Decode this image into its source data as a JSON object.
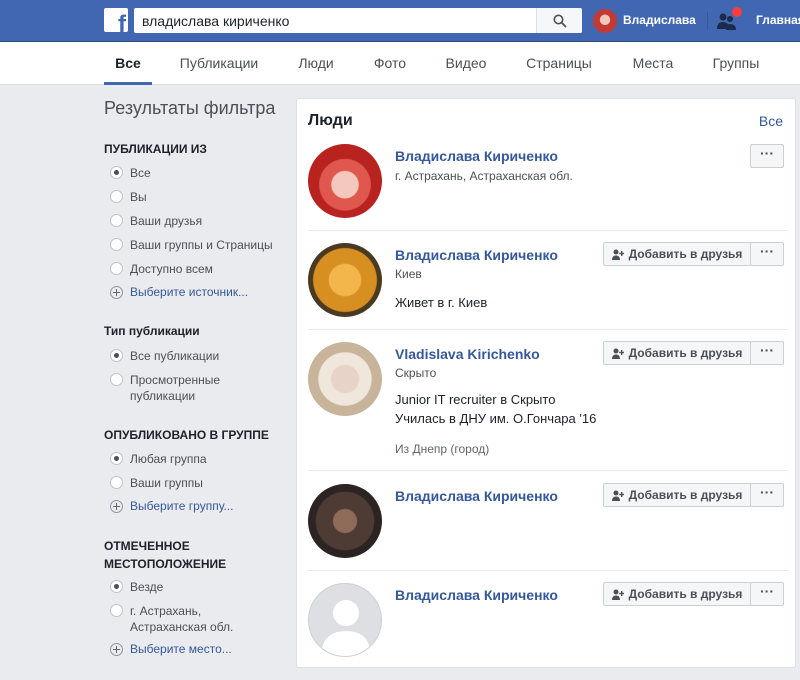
{
  "topbar": {
    "logo_letter": "f",
    "search_value": "владислава кириченко",
    "search_icon": "search-icon",
    "user_name": "Владислава",
    "home_label": "Главная"
  },
  "tabs": [
    {
      "label": "Все",
      "active": true
    },
    {
      "label": "Публикации"
    },
    {
      "label": "Люди"
    },
    {
      "label": "Фото"
    },
    {
      "label": "Видео"
    },
    {
      "label": "Страницы"
    },
    {
      "label": "Места"
    },
    {
      "label": "Группы"
    }
  ],
  "sidebar": {
    "title": "Результаты фильтра",
    "posts_from": {
      "heading": "ПУБЛИКАЦИИ ИЗ",
      "options": [
        "Все",
        "Вы",
        "Ваши друзья",
        "Ваши группы и Страницы",
        "Доступно всем"
      ],
      "selected": "Все",
      "choose_link": "Выберите источник..."
    },
    "post_type": {
      "heading": "Тип публикации",
      "options": [
        "Все публикации",
        "Просмотренные публикации"
      ],
      "selected": "Все публикации"
    },
    "posted_in_group": {
      "heading": "ОПУБЛИКОВАНО В ГРУППЕ",
      "options": [
        "Любая группа",
        "Ваши группы"
      ],
      "selected": "Любая группа",
      "choose_link": "Выберите группу..."
    },
    "tagged_location": {
      "heading": "ОТМЕЧЕННОЕ МЕСТОПОЛОЖЕНИЕ",
      "options": [
        "Везде",
        "г. Астрахань, Астраханская обл."
      ],
      "selected": "Везде",
      "choose_link": "Выберите место..."
    }
  },
  "people": {
    "title": "Люди",
    "see_all": "Все",
    "add_friend_label": "Добавить в друзья",
    "more_label": "···",
    "results": [
      {
        "name": "Владислава Кириченко",
        "line1": "г. Астрахань, Астраханская обл.",
        "line2": "",
        "line3": "",
        "line4": "",
        "has_add": false
      },
      {
        "name": "Владислава Кириченко",
        "line1": "Киев",
        "line2": "Живет в г. Киев",
        "line3": "",
        "line4": "",
        "has_add": true
      },
      {
        "name": "Vladislava Kirichenko",
        "line1": "Скрыто",
        "line2": "Junior IT recruiter в Скрыто",
        "line3": "Училась в ДНУ им. О.Гончара '16",
        "line4": "Из Днепр (город)",
        "has_add": true
      },
      {
        "name": "Владислава Кириченко",
        "line1": "",
        "line2": "",
        "line3": "",
        "line4": "",
        "has_add": true
      },
      {
        "name": "Владислава Кириченко",
        "line1": "",
        "line2": "",
        "line3": "",
        "line4": "",
        "has_add": true
      }
    ]
  }
}
